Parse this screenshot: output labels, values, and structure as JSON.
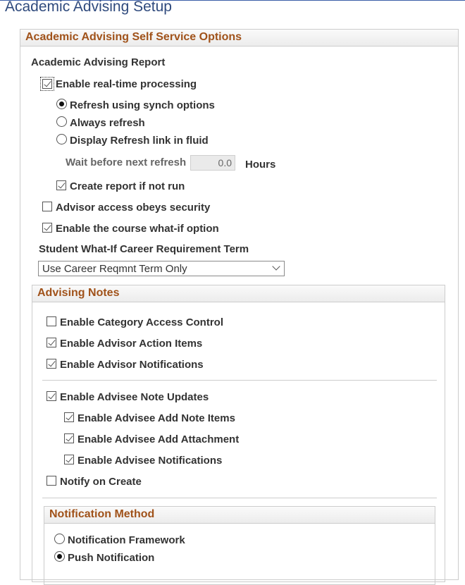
{
  "page_title": "Academic Advising Setup",
  "self_service": {
    "header": "Academic Advising Self Service Options",
    "report_section_label": "Academic Advising Report",
    "enable_realtime_label": "Enable real-time processing",
    "refresh_options": [
      "Refresh using synch options",
      "Always refresh",
      "Display Refresh link in fluid"
    ],
    "wait_label": "Wait before next refresh",
    "wait_value": "0.0",
    "wait_unit": "Hours",
    "create_report_label": "Create report if not run",
    "advisor_access_label": "Advisor access obeys security",
    "what_if_label": "Enable the course what-if option",
    "career_term_label": "Student What-If Career Requirement Term",
    "career_term_value": "Use  Career Reqmnt Term Only"
  },
  "advising_notes": {
    "header": "Advising Notes",
    "category_access_label": "Enable Category Access Control",
    "action_items_label": "Enable Advisor Action Items",
    "advisor_notifications_label": "Enable Advisor Notifications",
    "advisee_updates_label": "Enable Advisee Note Updates",
    "advisee_add_items_label": "Enable Advisee Add Note Items",
    "advisee_attachment_label": "Enable Advisee Add Attachment",
    "advisee_notifications_label": "Enable Advisee Notifications",
    "notify_on_create_label": "Notify on Create"
  },
  "notification_method": {
    "header": "Notification Method",
    "options": [
      "Notification Framework",
      "Push Notification"
    ]
  }
}
